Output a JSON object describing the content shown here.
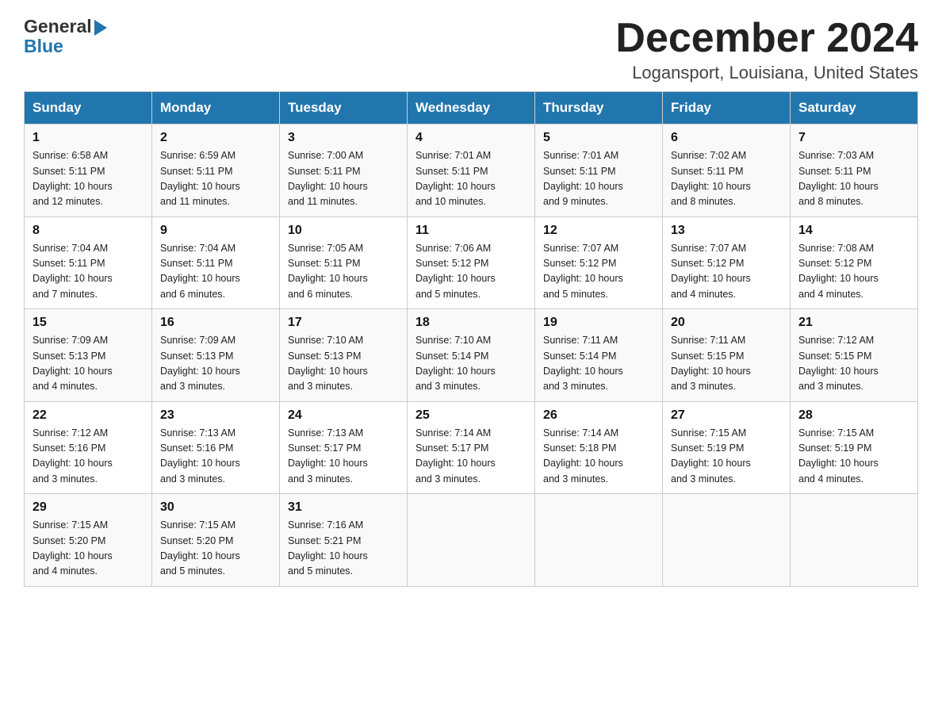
{
  "header": {
    "logo_general": "General",
    "logo_blue": "Blue",
    "month_title": "December 2024",
    "location": "Logansport, Louisiana, United States"
  },
  "days_of_week": [
    "Sunday",
    "Monday",
    "Tuesday",
    "Wednesday",
    "Thursday",
    "Friday",
    "Saturday"
  ],
  "weeks": [
    [
      {
        "day": "1",
        "sunrise": "6:58 AM",
        "sunset": "5:11 PM",
        "daylight": "10 hours and 12 minutes."
      },
      {
        "day": "2",
        "sunrise": "6:59 AM",
        "sunset": "5:11 PM",
        "daylight": "10 hours and 11 minutes."
      },
      {
        "day": "3",
        "sunrise": "7:00 AM",
        "sunset": "5:11 PM",
        "daylight": "10 hours and 11 minutes."
      },
      {
        "day": "4",
        "sunrise": "7:01 AM",
        "sunset": "5:11 PM",
        "daylight": "10 hours and 10 minutes."
      },
      {
        "day": "5",
        "sunrise": "7:01 AM",
        "sunset": "5:11 PM",
        "daylight": "10 hours and 9 minutes."
      },
      {
        "day": "6",
        "sunrise": "7:02 AM",
        "sunset": "5:11 PM",
        "daylight": "10 hours and 8 minutes."
      },
      {
        "day": "7",
        "sunrise": "7:03 AM",
        "sunset": "5:11 PM",
        "daylight": "10 hours and 8 minutes."
      }
    ],
    [
      {
        "day": "8",
        "sunrise": "7:04 AM",
        "sunset": "5:11 PM",
        "daylight": "10 hours and 7 minutes."
      },
      {
        "day": "9",
        "sunrise": "7:04 AM",
        "sunset": "5:11 PM",
        "daylight": "10 hours and 6 minutes."
      },
      {
        "day": "10",
        "sunrise": "7:05 AM",
        "sunset": "5:11 PM",
        "daylight": "10 hours and 6 minutes."
      },
      {
        "day": "11",
        "sunrise": "7:06 AM",
        "sunset": "5:12 PM",
        "daylight": "10 hours and 5 minutes."
      },
      {
        "day": "12",
        "sunrise": "7:07 AM",
        "sunset": "5:12 PM",
        "daylight": "10 hours and 5 minutes."
      },
      {
        "day": "13",
        "sunrise": "7:07 AM",
        "sunset": "5:12 PM",
        "daylight": "10 hours and 4 minutes."
      },
      {
        "day": "14",
        "sunrise": "7:08 AM",
        "sunset": "5:12 PM",
        "daylight": "10 hours and 4 minutes."
      }
    ],
    [
      {
        "day": "15",
        "sunrise": "7:09 AM",
        "sunset": "5:13 PM",
        "daylight": "10 hours and 4 minutes."
      },
      {
        "day": "16",
        "sunrise": "7:09 AM",
        "sunset": "5:13 PM",
        "daylight": "10 hours and 3 minutes."
      },
      {
        "day": "17",
        "sunrise": "7:10 AM",
        "sunset": "5:13 PM",
        "daylight": "10 hours and 3 minutes."
      },
      {
        "day": "18",
        "sunrise": "7:10 AM",
        "sunset": "5:14 PM",
        "daylight": "10 hours and 3 minutes."
      },
      {
        "day": "19",
        "sunrise": "7:11 AM",
        "sunset": "5:14 PM",
        "daylight": "10 hours and 3 minutes."
      },
      {
        "day": "20",
        "sunrise": "7:11 AM",
        "sunset": "5:15 PM",
        "daylight": "10 hours and 3 minutes."
      },
      {
        "day": "21",
        "sunrise": "7:12 AM",
        "sunset": "5:15 PM",
        "daylight": "10 hours and 3 minutes."
      }
    ],
    [
      {
        "day": "22",
        "sunrise": "7:12 AM",
        "sunset": "5:16 PM",
        "daylight": "10 hours and 3 minutes."
      },
      {
        "day": "23",
        "sunrise": "7:13 AM",
        "sunset": "5:16 PM",
        "daylight": "10 hours and 3 minutes."
      },
      {
        "day": "24",
        "sunrise": "7:13 AM",
        "sunset": "5:17 PM",
        "daylight": "10 hours and 3 minutes."
      },
      {
        "day": "25",
        "sunrise": "7:14 AM",
        "sunset": "5:17 PM",
        "daylight": "10 hours and 3 minutes."
      },
      {
        "day": "26",
        "sunrise": "7:14 AM",
        "sunset": "5:18 PM",
        "daylight": "10 hours and 3 minutes."
      },
      {
        "day": "27",
        "sunrise": "7:15 AM",
        "sunset": "5:19 PM",
        "daylight": "10 hours and 3 minutes."
      },
      {
        "day": "28",
        "sunrise": "7:15 AM",
        "sunset": "5:19 PM",
        "daylight": "10 hours and 4 minutes."
      }
    ],
    [
      {
        "day": "29",
        "sunrise": "7:15 AM",
        "sunset": "5:20 PM",
        "daylight": "10 hours and 4 minutes."
      },
      {
        "day": "30",
        "sunrise": "7:15 AM",
        "sunset": "5:20 PM",
        "daylight": "10 hours and 5 minutes."
      },
      {
        "day": "31",
        "sunrise": "7:16 AM",
        "sunset": "5:21 PM",
        "daylight": "10 hours and 5 minutes."
      },
      null,
      null,
      null,
      null
    ]
  ],
  "labels": {
    "sunrise_prefix": "Sunrise: ",
    "sunset_prefix": "Sunset: ",
    "daylight_prefix": "Daylight: "
  }
}
